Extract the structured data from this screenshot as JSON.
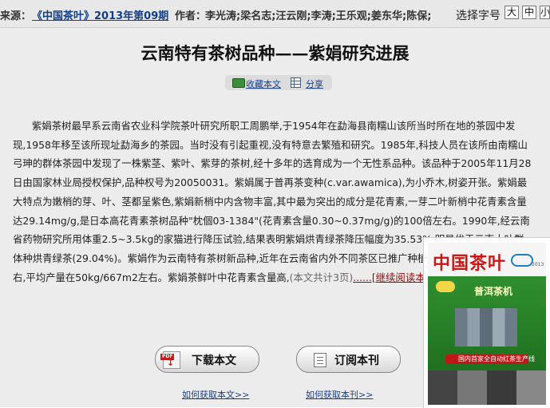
{
  "header": {
    "source_label": "来源：",
    "source_link": "《中国茶叶》2013年第09期",
    "authors_label": "作者：",
    "authors": "李光涛;梁名志;汪云刚;李涛;王乐观;姜东华;陈保;",
    "font_size_label": "选择字号",
    "font_sizes": [
      "大",
      "中",
      "小"
    ]
  },
  "article": {
    "title": "云南特有茶树品种——紫娟研究进展",
    "favorite_label": "收藏本文",
    "share_label": "分享",
    "body": "紫娟茶树最早系云南省农业科学院茶叶研究所职工周鹏举,于1954年在勐海县南糯山该所当时所在地的茶园中发现,1958年移至该所现址勐海乡的茶园。当时没有引起重视,没有特意去繁殖和研究。1985年,科技人员在该所由南糯山弓珅的群体茶园中发现了一株紫茎、紫叶、紫芽的茶树,经十多年的选育成为一个无性系品种。该品种于2005年11月28日由国家林业局授权保护,品种权号为20050031。紫娟属于普再茶变种(c.var.awamica),为小乔木,树姿开张。紫娟最大特点为嫩梢的芽、叶、茎都呈紫色,紫娟新梢中内含物丰富,其中最为突出的成分是花青素,一芽二叶新梢中花青素含量达29.14mg/g,是日本高花青素茶树品种\"枕個03-1384\"(花青素含量0.30~0.37mg/g)的100倍左右。1990年,经云南省药物研究所用体重2.5~3.5kg的家猫进行降压试验,结果表明紫娟烘青绿茶降压幅度为35.53%,明显优于云南大叶群体种烘青绿茶(29.04%)。紫娟作为云南特有茶树新品种,近年在云南省内外不同茶区已推广种植面积达4300万hm2左右,平均产量在50kg/667m2左右。紫娟茶鲜叶中花青素含量高,",
    "more_note": "(本文共计3页)",
    "more_link": "......[继续阅读本文]"
  },
  "actions": {
    "download_label": "下载本文",
    "subscribe_label": "订阅本刊",
    "how_download": "如何获取本文>>",
    "how_subscribe": "如何获取本刊>>"
  },
  "cover": {
    "magazine_title": "中国茶叶",
    "brand": "普洱茶机",
    "year": "2013",
    "red_strip": "国内首家全自动红茶生产线"
  },
  "icons": {
    "favorite": "folder-icon",
    "share": "share-grid-icon",
    "download": "pdf-icon",
    "subscribe": "document-icon"
  },
  "colors": {
    "link": "#1a3e86",
    "more_link": "#8a0f0f",
    "cover_title": "#c81818"
  }
}
